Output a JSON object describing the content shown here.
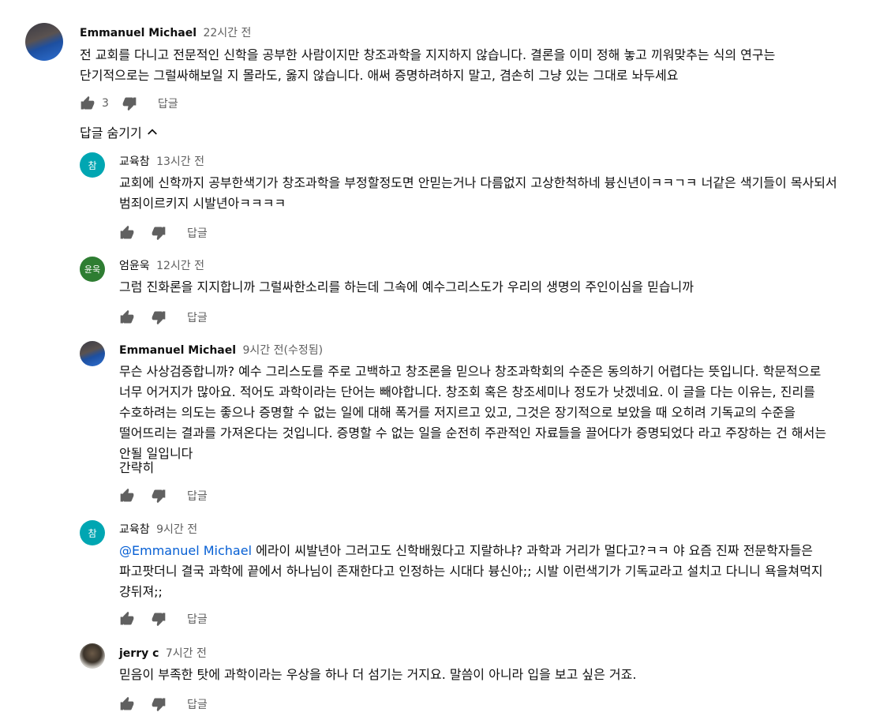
{
  "comments": [
    {
      "author": "Emmanuel Michael",
      "time": "22시간 전",
      "text": "전 교회를 다니고 전문적인 신학을 공부한 사람이지만 창조과학을 지지하지 않습니다. 결론을 이미 정해 놓고 끼워맞추는 식의 연구는 단기적으로는 그럴싸해보일 지 몰라도, 옳지 않습니다. 애써 증명하려하지 말고, 겸손히 그냥 있는 그대로 놔두세요",
      "likes": "3",
      "reply_label": "답글"
    }
  ],
  "hide_replies_label": "답글 숨기기",
  "replies": [
    {
      "author": "교육참",
      "avatar_letter": "참",
      "avatar_color": "#00a6b2",
      "time": "13시간 전",
      "text": "교회에 신학까지 공부한색기가 창조과학을 부정할정도면 안믿는거나 다름없지 고상한척하네 븅신년이ㅋㅋㄱㅋ 너같은 색기들이 목사되서 범죄이르키지 시발년아ㅋㅋㅋㅋ",
      "reply_label": "답글"
    },
    {
      "author": "엄윤욱",
      "avatar_letter": "윤욱",
      "avatar_color": "#2e7d32",
      "time": "12시간 전",
      "text": "그럼 진화론을 지지합니까 그럴싸한소리를 하는데 그속에  예수그리스도가 우리의 생명의 주인이심을 믿습니까",
      "reply_label": "답글"
    },
    {
      "author": "Emmanuel Michael",
      "time": "9시간 전(수정됨)",
      "text": "무슨 사상검증합니까? 예수 그리스도를 주로 고백하고 창조론을 믿으나 창조과학회의 수준은 동의하기 어렵다는 뜻입니다. 학문적으로 너무 어거지가 많아요. 적어도 과학이라는 단어는 빼야합니다. 창조회 혹은 창조세미나 정도가 낫겠네요. 이 글을 다는 이유는, 진리를 수호하려는 의도는 좋으나 증명할 수 없는 일에 대해 폭거를 저지르고 있고, 그것은 장기적으로 보았을 때 오히려 기독교의 수준을 떨어뜨리는 결과를 가져온다는 것입니다. 증명할 수 없는 일을 순전히 주관적인 자료들을 끌어다가 증명되었다 라고 주장하는 건 해서는 안될 일입니다",
      "text2": "간략히",
      "reply_label": "답글"
    },
    {
      "author": "교육참",
      "avatar_letter": "참",
      "avatar_color": "#00a6b2",
      "time": "9시간 전",
      "mention": "@Emmanuel Michael",
      "text": " 에라이 씨발년아 그러고도 신학배웠다고 지랄하냐? 과학과 거리가 멀다고?ㅋㅋ 야 요즘 진짜 전문학자들은 파고팟더니 결국 과학에 끝에서 하나님이 존재한다고 인정하는 시대다 븅신아;; 시발 이런색기가 기독교라고 설치고 다니니 욕을쳐먹지 걍뒤져;;",
      "reply_label": "답글"
    },
    {
      "author": "jerry c",
      "time": "7시간 전",
      "text": "믿음이 부족한 탓에 과학이라는 우상을 하나 더 섬기는 거지요. 말씀이 아니라 입을 보고 싶은 거죠.",
      "reply_label": "답글"
    }
  ]
}
